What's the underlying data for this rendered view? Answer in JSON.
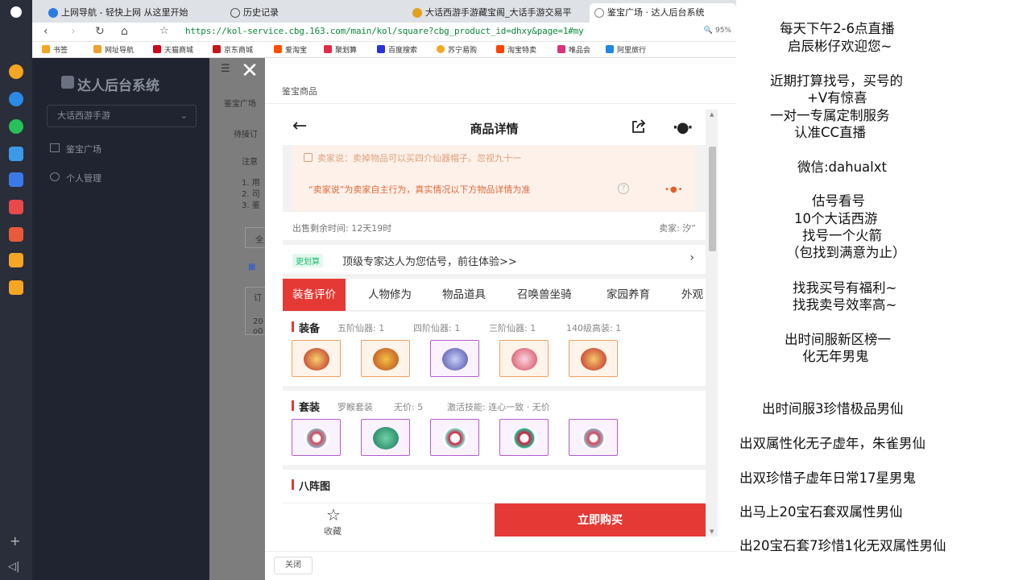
{
  "browser": {
    "tabs": [
      {
        "label": "上网导航 - 轻快上网 从这里开始",
        "color": "#2a7ae2"
      },
      {
        "label": "历史记录",
        "color": "#555555"
      },
      {
        "label": "大话西游手游藏宝阁_大话手游交易平",
        "color": "#e0a020"
      },
      {
        "label": "鉴宝广场 · 达人后台系统",
        "color": "#888888"
      }
    ],
    "url": "https://kol-service.cbg.163.com/main/kol/square?cbg_product_id=dhxy&page=1#my",
    "zoom": "95%",
    "bookmarks": [
      {
        "label": "书签",
        "color": "#f5a623"
      },
      {
        "label": "网址导航",
        "color": "#f0a030"
      },
      {
        "label": "天猫商城",
        "color": "#d0021b"
      },
      {
        "label": "京东商城",
        "color": "#c4161c"
      },
      {
        "label": "爱淘宝",
        "color": "#ff5000"
      },
      {
        "label": "聚划算",
        "color": "#e6294b"
      },
      {
        "label": "百度搜索",
        "color": "#2932e1"
      },
      {
        "label": "苏宁易购",
        "color": "#f5a623"
      },
      {
        "label": "淘宝特卖",
        "color": "#ff4400"
      },
      {
        "label": "唯品会",
        "color": "#e0307a"
      },
      {
        "label": "阿里旅行",
        "color": "#1e88e5"
      }
    ]
  },
  "admin": {
    "title": "达人后台系统",
    "game_select": "大话西游手游",
    "nav": [
      {
        "label": "鉴宝广场"
      },
      {
        "label": "个人管理"
      }
    ],
    "fragments": [
      "鉴宝广场",
      "待接订",
      "注意",
      "1. 用",
      "2. 司",
      "3. 鉴",
      "全",
      "订",
      "20",
      "o0"
    ]
  },
  "modal": {
    "title": "鉴宝商品",
    "close_label": "关闭"
  },
  "product": {
    "heading": "商品详情",
    "seller_note": "卖家说：卖掉物品可以买四介仙器帽子。忽视九十一",
    "disclaimer": "“卖家说”为卖家自主行为，真实情况以下方物品详情为准",
    "sale_time": "出售剩余时间: 12天19时",
    "seller": "卖家: 汐”",
    "appraisal_badge": "更划算",
    "appraisal_text": "顶级专家达人为您估号，前往体验>>",
    "tabs": [
      "装备评价",
      "人物修为",
      "物品道具",
      "召唤兽坐骑",
      "家园养育",
      "外观"
    ],
    "equipment": {
      "title": "装备",
      "meta": [
        "五阶仙器: 1",
        "四阶仙器: 1",
        "三阶仙器: 1",
        "140级高装: 1"
      ]
    },
    "suit": {
      "title": "套装",
      "meta": [
        "罗睺套装",
        "无价: 5",
        "激活技能: 连心一致 · 无价"
      ]
    },
    "formation": {
      "title": "八阵图"
    },
    "favorite_label": "收藏",
    "buy_label": "立即购买"
  },
  "stream": [
    "每天下午2-6点直播",
    "启辰彬仔欢迎您~",
    "近期打算找号，买号的",
    "+V有惊喜",
    "一对一专属定制服务",
    "认准CC直播",
    "微信:dahualxt",
    "估号看号",
    "10个大话西游",
    "找号一个火箭",
    "（包找到满意为止）",
    "找我买号有福利~",
    "找我卖号效率高~",
    "出时间服新区榜一",
    "化无年男鬼",
    "出时间服3珍惜极品男仙",
    "出双属性化无子虚年，朱雀男仙",
    "出双珍惜子虚年日常17星男鬼",
    "出马上20宝石套双属性男仙",
    "出20宝石套7珍惜1化无双属性男仙"
  ]
}
